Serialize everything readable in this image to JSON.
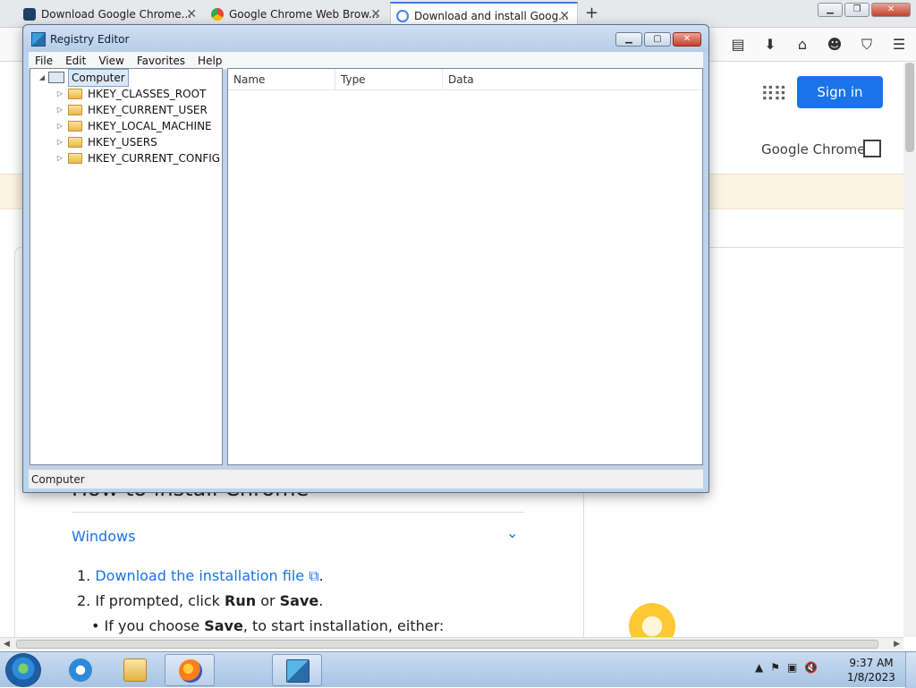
{
  "browser": {
    "tabs": [
      {
        "label": "Download Google Chrome...",
        "icon": "doc-icon",
        "active": false
      },
      {
        "label": "Google Chrome Web Brow...",
        "icon": "chrome-icon",
        "active": false
      },
      {
        "label": "Download and install Goog...",
        "icon": "google-icon",
        "active": true
      }
    ],
    "newtab_symbol": "+"
  },
  "webpage": {
    "signin_label": "Sign in",
    "product_link": "Google Chrome",
    "heading": "How to install Chrome",
    "accordion_title": "Windows",
    "steps": {
      "step1_link": "Download the installation file",
      "step1_after": ".",
      "step2_prefix": "If prompted, click ",
      "step2_run": "Run",
      "step2_or": " or ",
      "step2_save": "Save",
      "step2_after": ".",
      "bullet_prefix": "If you choose ",
      "bullet_save": "Save",
      "bullet_after": ", to start installation, either:"
    }
  },
  "regedit": {
    "title": "Registry Editor",
    "menu": [
      "File",
      "Edit",
      "View",
      "Favorites",
      "Help"
    ],
    "root": "Computer",
    "keys": [
      "HKEY_CLASSES_ROOT",
      "HKEY_CURRENT_USER",
      "HKEY_LOCAL_MACHINE",
      "HKEY_USERS",
      "HKEY_CURRENT_CONFIG"
    ],
    "columns": [
      "Name",
      "Type",
      "Data"
    ],
    "status": "Computer"
  },
  "taskbar": {
    "time": "9:37 AM",
    "date": "1/8/2023"
  },
  "colors": {
    "accent_blue": "#1a73e8",
    "banner": "#fdf3e1"
  }
}
